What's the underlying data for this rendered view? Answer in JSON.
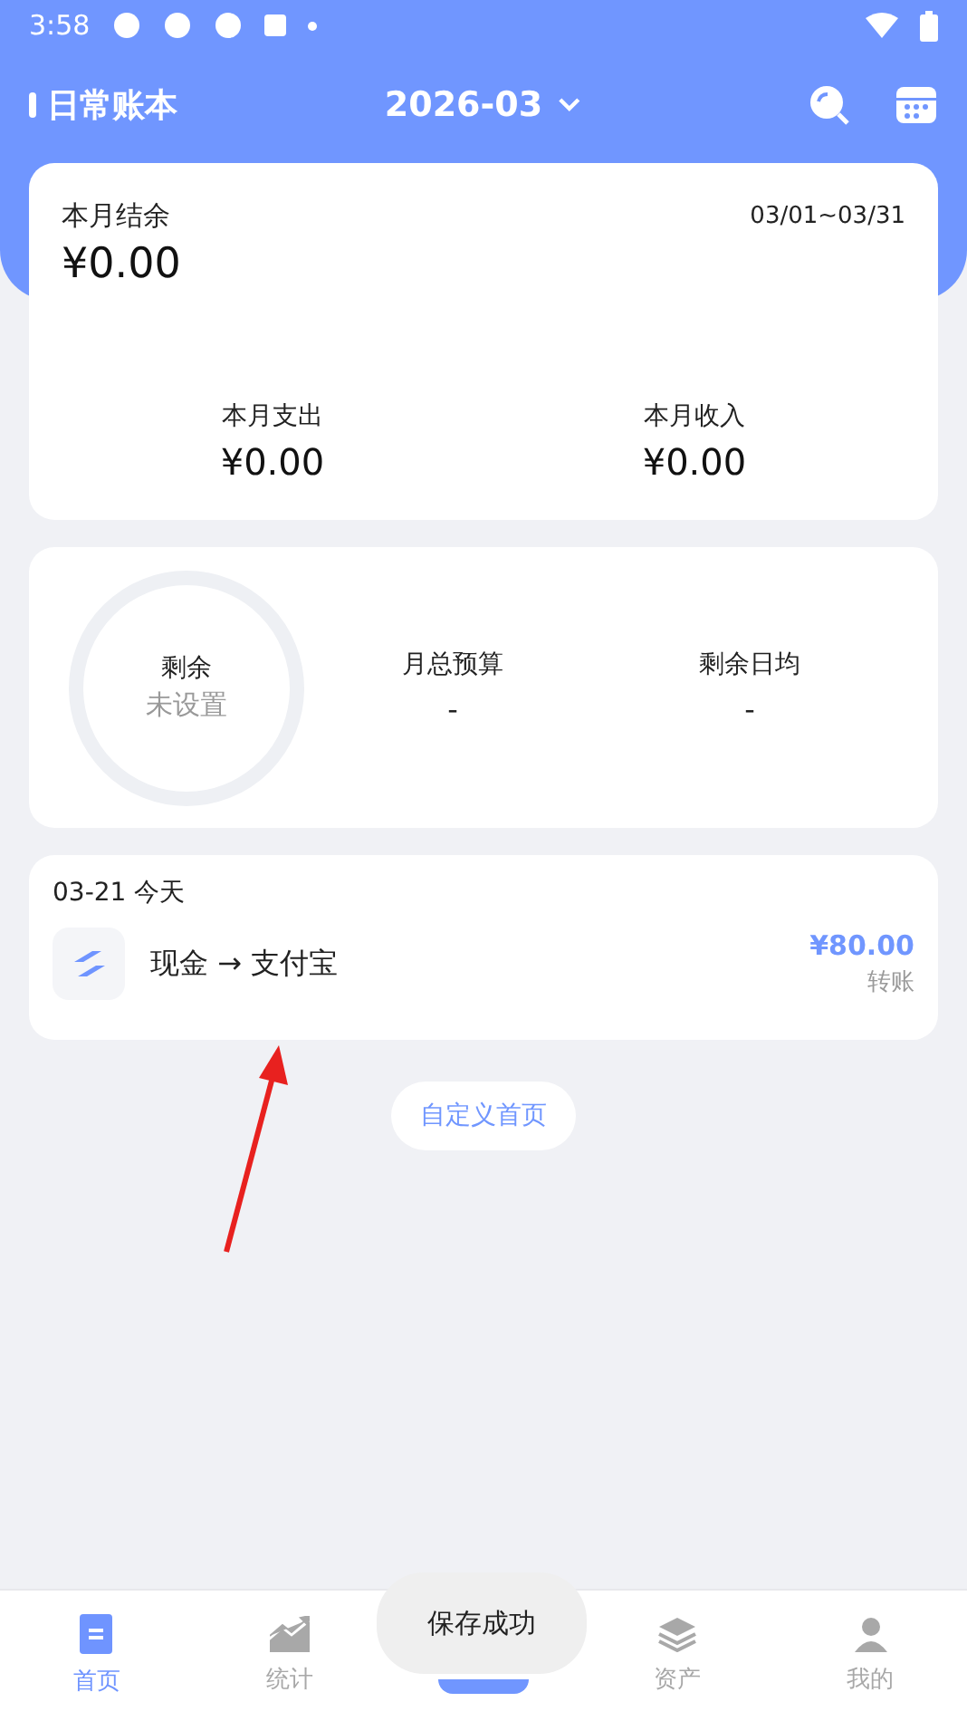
{
  "status_bar": {
    "time": "3:58"
  },
  "header": {
    "title": "日常账本",
    "month": "2026-03"
  },
  "summary": {
    "label": "本月结余",
    "range": "03/01~03/31",
    "balance": "¥0.00",
    "stats": [
      {
        "label": "本月支出",
        "value": "¥0.00"
      },
      {
        "label": "本月收入",
        "value": "¥0.00"
      }
    ]
  },
  "budget": {
    "ring_label": "剩余",
    "ring_value": "未设置",
    "stats": [
      {
        "label": "月总预算",
        "value": "-"
      },
      {
        "label": "剩余日均",
        "value": "-"
      }
    ]
  },
  "day_group": {
    "date": "03-21 今天",
    "entries": [
      {
        "title": "现金 → 支付宝",
        "amount": "¥80.00",
        "type": "转账"
      }
    ]
  },
  "customize_button": "自定义首页",
  "nav": [
    {
      "kind": "home",
      "label": "首页",
      "selected": true
    },
    {
      "kind": "stats",
      "label": "统计",
      "selected": false
    },
    {
      "kind": "add"
    },
    {
      "kind": "assets",
      "label": "资产",
      "selected": false
    },
    {
      "kind": "profile",
      "label": "我的",
      "selected": false
    }
  ],
  "toast": "保存成功"
}
